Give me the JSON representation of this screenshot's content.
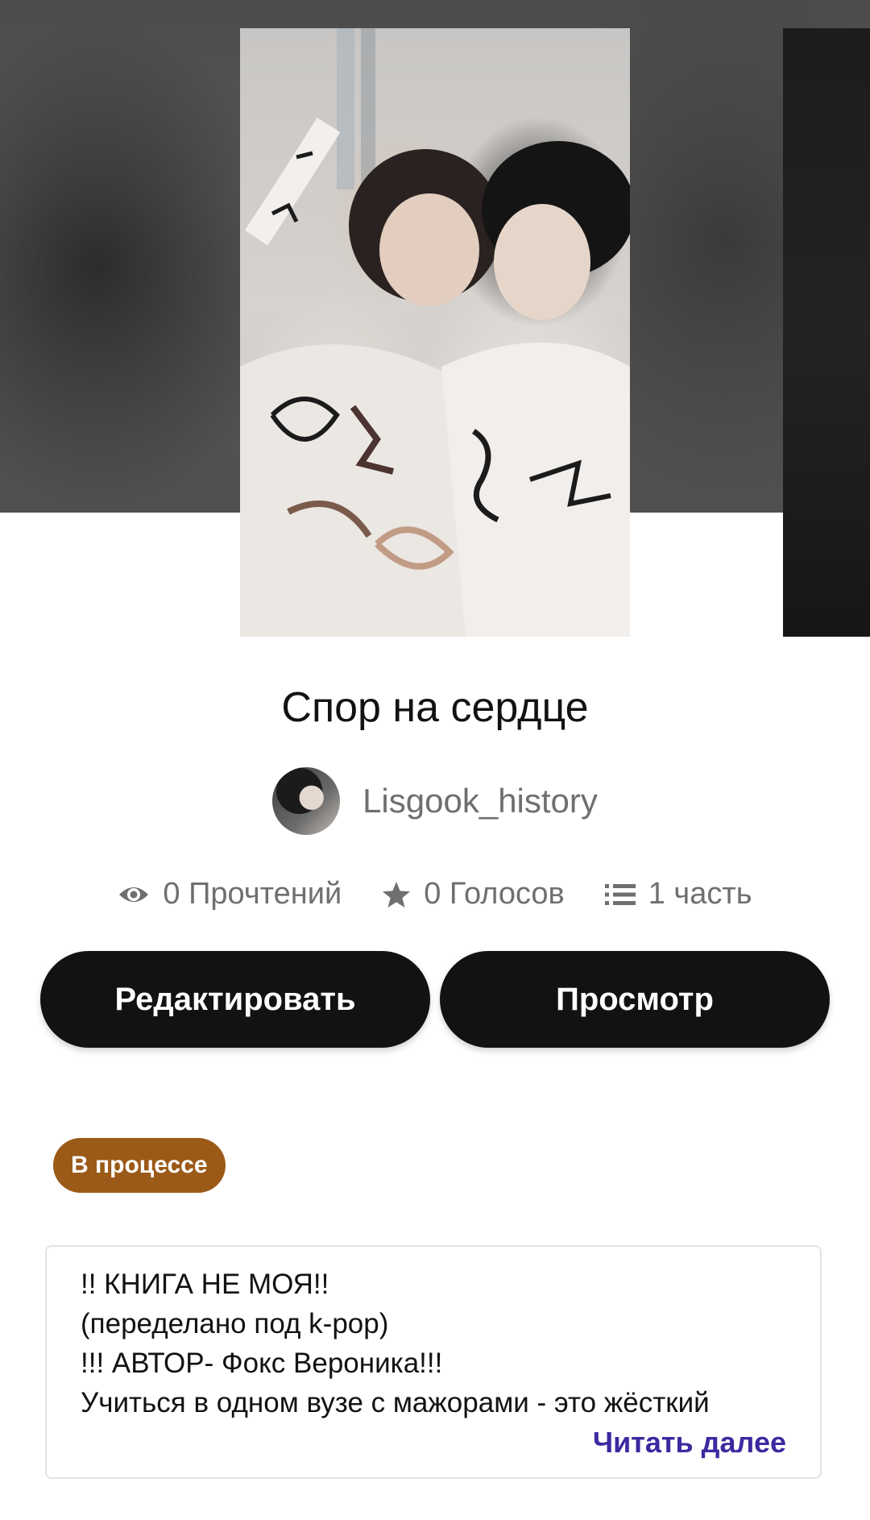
{
  "story": {
    "title": "Спор на сердце",
    "author": "Lisgook_history"
  },
  "stats": {
    "reads": "0 Прочтений",
    "votes": "0 Голосов",
    "parts": "1 часть"
  },
  "actions": {
    "edit_label": "Редактировать",
    "view_label": "Просмотр"
  },
  "status_badge": "В процессе",
  "description": {
    "lines": [
      "!! КНИГА НЕ МОЯ!!",
      "(переделано под k-pop)",
      "!!! АВТОР- Фокс Вероника!!!",
      "Учиться в одном вузе с мажорами - это жёсткий"
    ],
    "read_more": "Читать далее"
  },
  "icons": {
    "reads": "eye-icon",
    "votes": "star-icon",
    "parts": "list-icon"
  },
  "colors": {
    "button_bg": "#121212",
    "badge_bg": "#9b5a18",
    "link": "#3b2aa0"
  }
}
